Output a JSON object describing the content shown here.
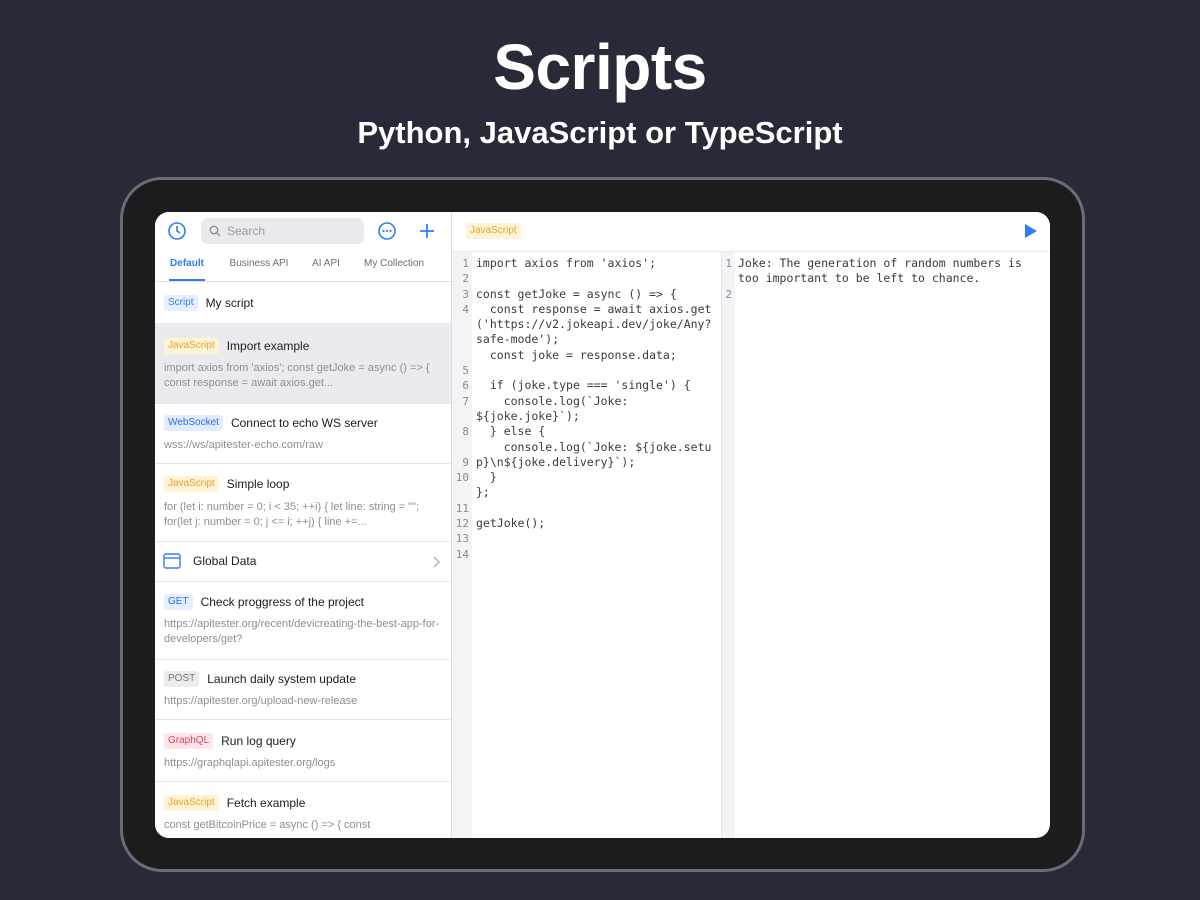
{
  "hero": {
    "title": "Scripts",
    "subtitle": "Python, JavaScript or TypeScript"
  },
  "sidebar": {
    "search_placeholder": "Search",
    "tabs": [
      "Default",
      "Business API",
      "AI API",
      "My Collection"
    ],
    "script_badge": "Script",
    "script_title": "My script",
    "items": [
      {
        "badge": "JavaScript",
        "title": "Import example",
        "sub": "import axios from 'axios'; const getJoke = async () => { const response = await axios.get..."
      },
      {
        "badge": "WebSocket",
        "title": "Connect to echo WS server",
        "sub": "wss://ws/apitester-echo.com/raw"
      },
      {
        "badge": "JavaScript",
        "title": "Simple loop",
        "sub": "for (let i: number = 0; i < 35; ++i) { let line: string = \"\"; for(let j: number = 0; j <= i; ++j) { line +=..."
      },
      {
        "title": "Global Data"
      },
      {
        "badge": "GET",
        "title": "Check proggress of the project",
        "sub": "https://apitester.org/recent/devicreating-the-best-app-for-developers/get?"
      },
      {
        "badge": "POST",
        "title": "Launch daily system update",
        "sub": "https://apitester.org/upload-new-release"
      },
      {
        "badge": "GraphQL",
        "title": "Run log query",
        "sub": "https://graphqlapi.apitester.org/logs"
      },
      {
        "badge": "JavaScript",
        "title": "Fetch example",
        "sub": "const getBitcoinPrice = async () => { const"
      }
    ]
  },
  "editor": {
    "language": "JavaScript",
    "code_lines": [
      "import axios from 'axios';",
      "",
      "const getJoke = async () => {",
      "  const response = await axios.get('https://v2.jokeapi.dev/joke/Any?safe-mode');",
      "  const joke = response.data;",
      "",
      "  if (joke.type === 'single') {",
      "    console.log(`Joke: ${joke.joke}`);",
      "  } else {",
      "    console.log(`Joke: ${joke.setup}\\n${joke.delivery}`);",
      "  }",
      "};",
      "",
      "getJoke();"
    ],
    "output_lines": [
      "Joke: The generation of random numbers is too important to be left to chance.",
      ""
    ]
  },
  "colors": {
    "accent": "#2f7cf6",
    "background": "#292a38"
  }
}
